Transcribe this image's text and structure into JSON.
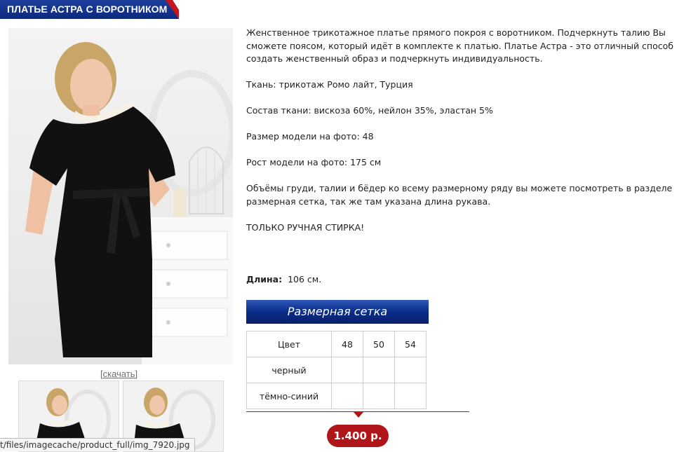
{
  "product": {
    "title": "ПЛАТЬЕ АСТРА С ВОРОТНИКОМ",
    "download_label": "[скачать]"
  },
  "description": {
    "paragraphs": [
      "Женственное трикотажное платье прямого покроя с воротником. Подчеркнуть талию Вы сможете поясом, который идёт в комплекте к платью. Платье Астра - это отличный способ создать женственный образ и подчеркнуть индивидуальность.",
      "Ткань: трикотаж Ромо лайт, Турция",
      "Состав ткани: вискоза 60%, нейлон 35%, эластан 5%",
      "Размер модели на фото: 48",
      "Рост модели на фото: 175 см",
      "Объёмы груди, талии и бёдер ко всему размерному ряду вы можете посмотреть в разделе размерная сетка, так же там указана длина рукава.",
      "ТОЛЬКО РУЧНАЯ СТИРКА!"
    ]
  },
  "length": {
    "label": "Длина:",
    "value": "106 см."
  },
  "size_chart": {
    "button_label": "Размерная сетка",
    "header": [
      "Цвет",
      "48",
      "50",
      "54"
    ],
    "rows": [
      [
        "черный",
        "",
        "",
        ""
      ],
      [
        "тёмно-синий",
        "",
        "",
        ""
      ]
    ]
  },
  "price": "1.400 р.",
  "status_bar": {
    "url": "t/files/imagecache/product_full/img_7920.jpg"
  },
  "colors": {
    "banner_blue": "#0d2a7d",
    "accent_red": "#b01519",
    "button_blue": "#0c2f8c"
  }
}
